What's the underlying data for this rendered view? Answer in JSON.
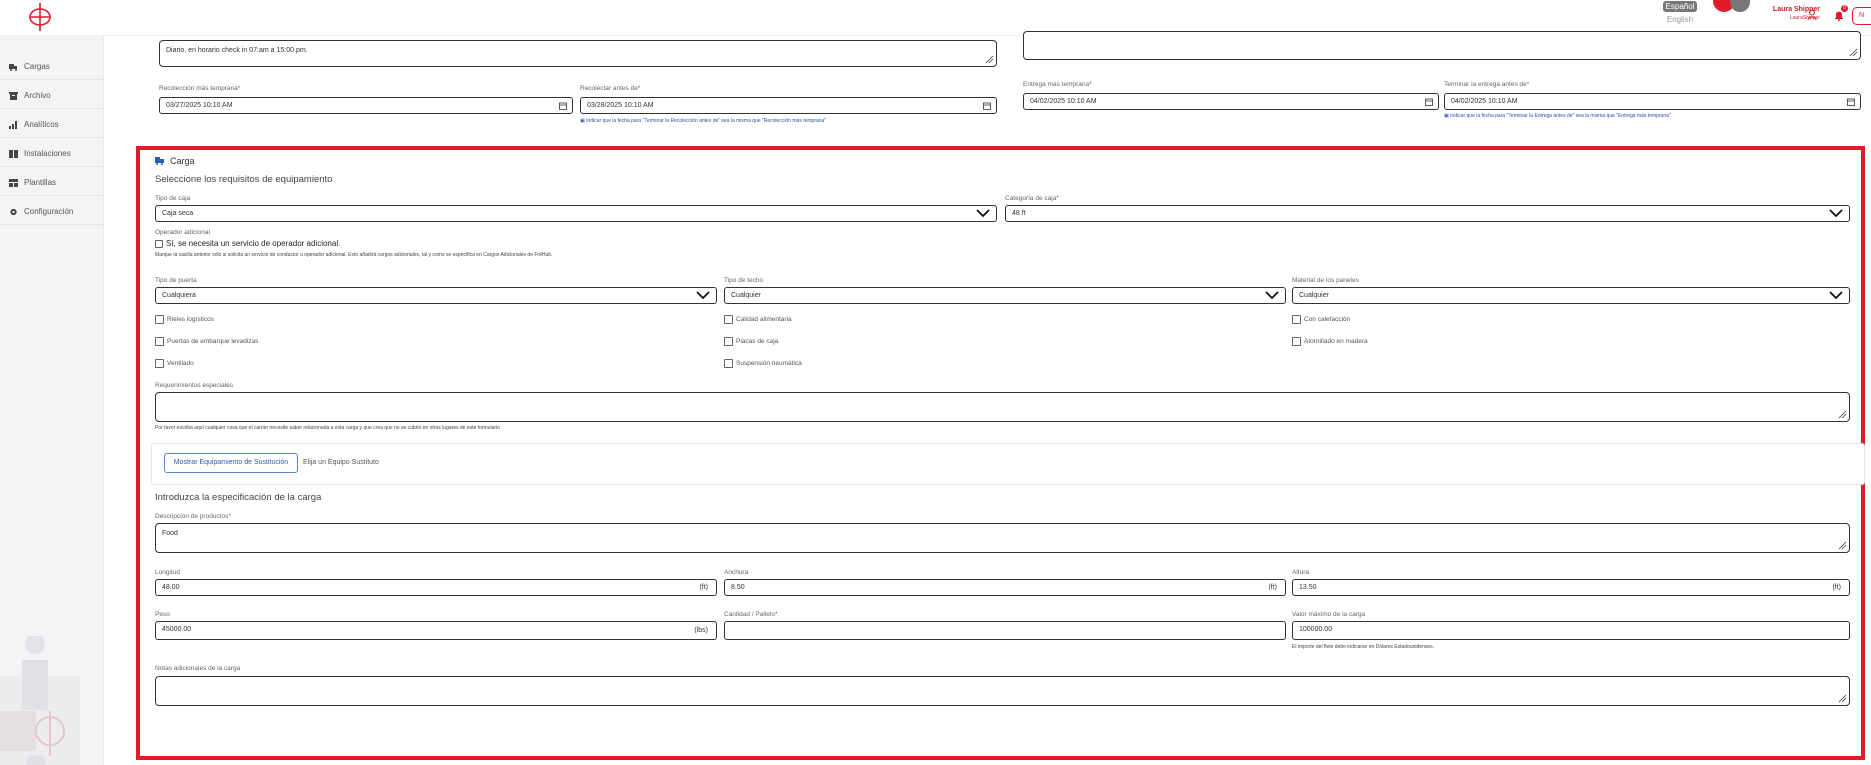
{
  "header": {
    "lang_active": "Español",
    "lang_other": "English",
    "user_name": "Laura Shipper",
    "user_role": "LauraShipper",
    "notification_count": "0",
    "button_label": "N"
  },
  "sidebar": {
    "items": [
      {
        "label": "Cargas"
      },
      {
        "label": "Archivo"
      },
      {
        "label": "Analíticos"
      },
      {
        "label": "Instalaciones"
      },
      {
        "label": "Plantillas"
      },
      {
        "label": "Configuración"
      }
    ]
  },
  "pickup": {
    "instructions_value": "Diario, en horario check in 07:am a 15:00 pm.",
    "earliest_label": "Recolección más temprana*",
    "earliest_value": "03/27/2025  10:10 AM",
    "latest_label": "Recolectar antes de*",
    "latest_value": "03/28/2025  10:10 AM",
    "hint": "Indicar que la fecha para \"Terminar la Recolección antes de\" sea la misma que \"Recolección más temprana\""
  },
  "delivery": {
    "earliest_label": "Entrega más temprana*",
    "earliest_value": "04/02/2025  10:10 AM",
    "latest_label": "Terminar la entrega antes de*",
    "latest_value": "04/02/2025  10:10 AM",
    "hint": "Indicar que la fecha para \"Terminar la Entrega antes de\" sea la misma que \"Entrega más temprana\""
  },
  "cargo": {
    "title": "Carga",
    "equipment_heading": "Seleccione los requisitos de equipamiento",
    "box_type_label": "Tipo de caja",
    "box_type_value": "Caja seca",
    "box_category_label": "Categoría de caja*",
    "box_category_value": "48 ft",
    "extra_operator_label": "Operador adicional",
    "extra_operator_check": "Sí, se necesita un servicio de operador adicional.",
    "extra_operator_hint": "Marque la casilla anterior sólo si solicita un servicio de conductor u operador adicional. Esto añadirá cargos adicionales, tal y como se especifica en Cargos Adicionales de FrēHub.",
    "door_label": "Tipo de puerta",
    "door_value": "Cualquiera",
    "roof_label": "Tipo de techo",
    "roof_value": "Cualquier",
    "panel_label": "Material de los paneles",
    "panel_value": "Cualquier",
    "checks": [
      "Rieles logísticos",
      "Calidad alimentaria",
      "Con calefacción",
      "Puertas de embarque levadizas",
      "Placas de caja",
      "Atornillado en madera",
      "Ventilado",
      "Suspensión neumática"
    ],
    "special_label": "Requerimientos especiales",
    "special_hint": "Por favor escriba aquí cualquier cosa que el carrier necesite saber relacionada a esta carga y que crea que no se cubrió en otros lugares de este formulario",
    "subst_button": "Mostrar Equipamiento de Sustitución",
    "subst_label": "Elija un Equipo Sustituto",
    "spec_heading": "Introduzca la especificación de la carga",
    "desc_label": "Descripción de productos*",
    "desc_value": "Food",
    "length_label": "Longitud",
    "length_value": "48.00",
    "length_unit": "(ft)",
    "width_label": "Anchura",
    "width_value": "8.50",
    "width_unit": "(ft)",
    "height_label": "Altura",
    "height_value": "13.50",
    "height_unit": "(ft)",
    "weight_label": "Peso",
    "weight_value": "45000.00",
    "weight_unit": "(lbs)",
    "qty_label": "Cantidad / Pallets*",
    "qty_value": "",
    "max_value_label": "Valor máximo de la carga",
    "max_value_value": "100000.00",
    "max_value_hint": "El importe del flete debe indicarse en Dólares Estadounidenses.",
    "notes_label": "Notas adicionales de la carga",
    "notes_value": ""
  },
  "colors": {
    "accent": "#e01c2a",
    "link": "#2c5db0"
  }
}
